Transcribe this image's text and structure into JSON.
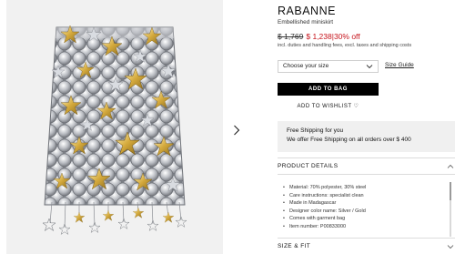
{
  "product": {
    "brand": "RABANNE",
    "name": "Embellished miniskirt",
    "old_price": "$ 1,769",
    "new_price": "$ 1,238",
    "discount": "|30% off",
    "tax_note": "incl. duties and handling fees, excl. taxes and shipping costs"
  },
  "size": {
    "placeholder": "Choose your size",
    "guide_label": "Size Guide"
  },
  "actions": {
    "add_to_bag": "ADD TO BAG",
    "add_to_wishlist": "ADD TO WISHLIST ♡"
  },
  "shipping": {
    "title": "Free Shipping for you",
    "text": "We offer Free Shipping on all orders over $ 400"
  },
  "sections": {
    "product_details": "PRODUCT DETAILS",
    "size_fit": "SIZE & FIT"
  },
  "details": [
    "Material: 70% polyester, 30% steel",
    "Care instructions: specialist clean",
    "Made in Madagascar",
    "Designer color name: Silver / Gold",
    "Comes with garment bag",
    "Item number: P00833000"
  ],
  "icons": {
    "next": "chevron-right-icon",
    "select": "chevron-down-icon",
    "collapse": "chevron-up-icon",
    "expand": "chevron-down-icon"
  },
  "colors": {
    "sale": "#c6131b",
    "button": "#000000",
    "ship_bg": "#f0f0f0"
  }
}
